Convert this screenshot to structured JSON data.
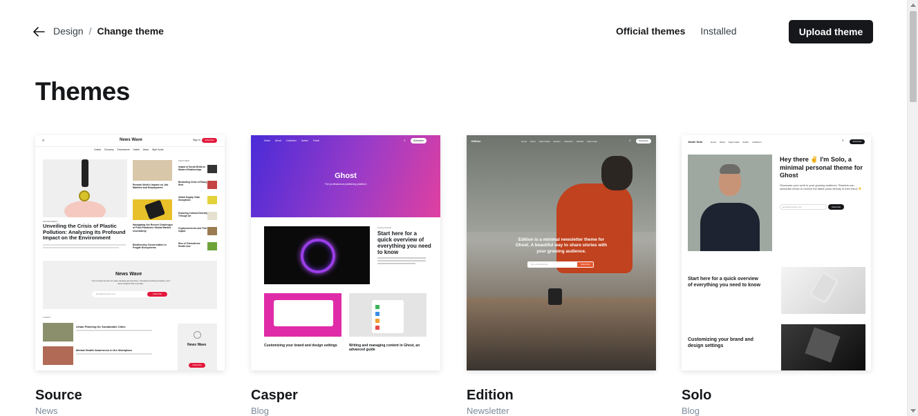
{
  "nav": {
    "crumb_parent": "Design",
    "crumb_separator": "/",
    "crumb_current": "Change theme",
    "tabs": [
      "Official themes",
      "Installed"
    ],
    "upload_label": "Upload theme"
  },
  "page_title": "Themes",
  "themes": [
    {
      "name": "Source",
      "category": "News",
      "preview": {
        "site": "News Wave",
        "sign_in": "Sign in",
        "subscribe": "Subscribe",
        "menu": [
          "Culture",
          "Economy",
          "Environment",
          "Health",
          "About",
          "Style Guide"
        ],
        "hero_tag": "ENVIRONMENT",
        "hero_title": "Unveiling the Crisis of Plastic Pollution: Analyzing Its Profound Impact on the Environment",
        "mid_items": [
          "Remote Work's Impact on Job Markets and Employment",
          "Navigating the Recent Challenges of Post-Pandemic Global Market Uncertainty",
          "Biodiversity Conservation in Fragile Ecosystems"
        ],
        "featured_label": "FEATURED",
        "side_items": [
          "Impact of Social Media on Modern Relationships",
          "Bestselling Crisis of Rising Rent",
          "Global Supply Chain Disruptions",
          "Exploring Cultural Diversity Through Art",
          "Cryptocurrencies and Their Impact",
          "Rise of Telemedicine Health Care"
        ],
        "banner_title": "News Wave",
        "banner_text": "Your trusted source for wide-ranging perspectives, thought-provoking analysis, and deep insights that resonate.",
        "email_placeholder": "jamie@example.com",
        "latest_label": "LATEST",
        "latest_items": [
          "Urban Planning for Sustainable Cities",
          "Mental Health Awareness in the Workplace"
        ],
        "side_card_title": "News Wave"
      }
    },
    {
      "name": "Casper",
      "category": "Blog",
      "preview": {
        "menu": [
          "Home",
          "About",
          "Collection",
          "Author",
          "Portal"
        ],
        "subscribe": "Subscribe",
        "logo": "Ghost",
        "tagline": "The professional publishing platform",
        "post_tag": "Getting Started",
        "post_title": "Start here for a quick overview of everything you need to know",
        "cards": [
          "Customizing your brand and design settings",
          "Writing and managing content in Ghost, an advanced guide"
        ]
      }
    },
    {
      "name": "Edition",
      "category": "Newsletter",
      "preview": {
        "site": "Edition",
        "menu": [
          "Home",
          "About",
          "Style Guide",
          "Authors",
          "Collection",
          "Sidebar",
          "Dark mode"
        ],
        "subscribe": "Subscribe",
        "headline": "Edition is a minimal newsletter theme for Ghost. A beautiful way to share stories with your growing audience.",
        "email_placeholder": "Your email address",
        "button": "Subscribe"
      }
    },
    {
      "name": "Solo",
      "category": "Blog",
      "preview": {
        "site": "Jamie Solo",
        "menu": [
          "Home",
          "About",
          "Style Guide",
          "Author",
          "Collection"
        ],
        "subscribe": "Subscribe",
        "headline": "Hey there ✌ I'm Solo, a minimal personal theme for Ghost",
        "subtext": "Showcase your work to your growing audience. Readers can subscribe below to receive the latest posts directly in their inbox 👇",
        "email_placeholder": "jamie@example.com",
        "posts": [
          "Start here for a quick overview of everything you need to know",
          "Customizing your brand and design settings"
        ]
      }
    }
  ],
  "colors": {
    "accent_red": "#e3193c",
    "dark": "#15171a",
    "casper_gradient_start": "#4a2bd8",
    "casper_gradient_end": "#e040a0",
    "muted": "#7c8b9a"
  }
}
